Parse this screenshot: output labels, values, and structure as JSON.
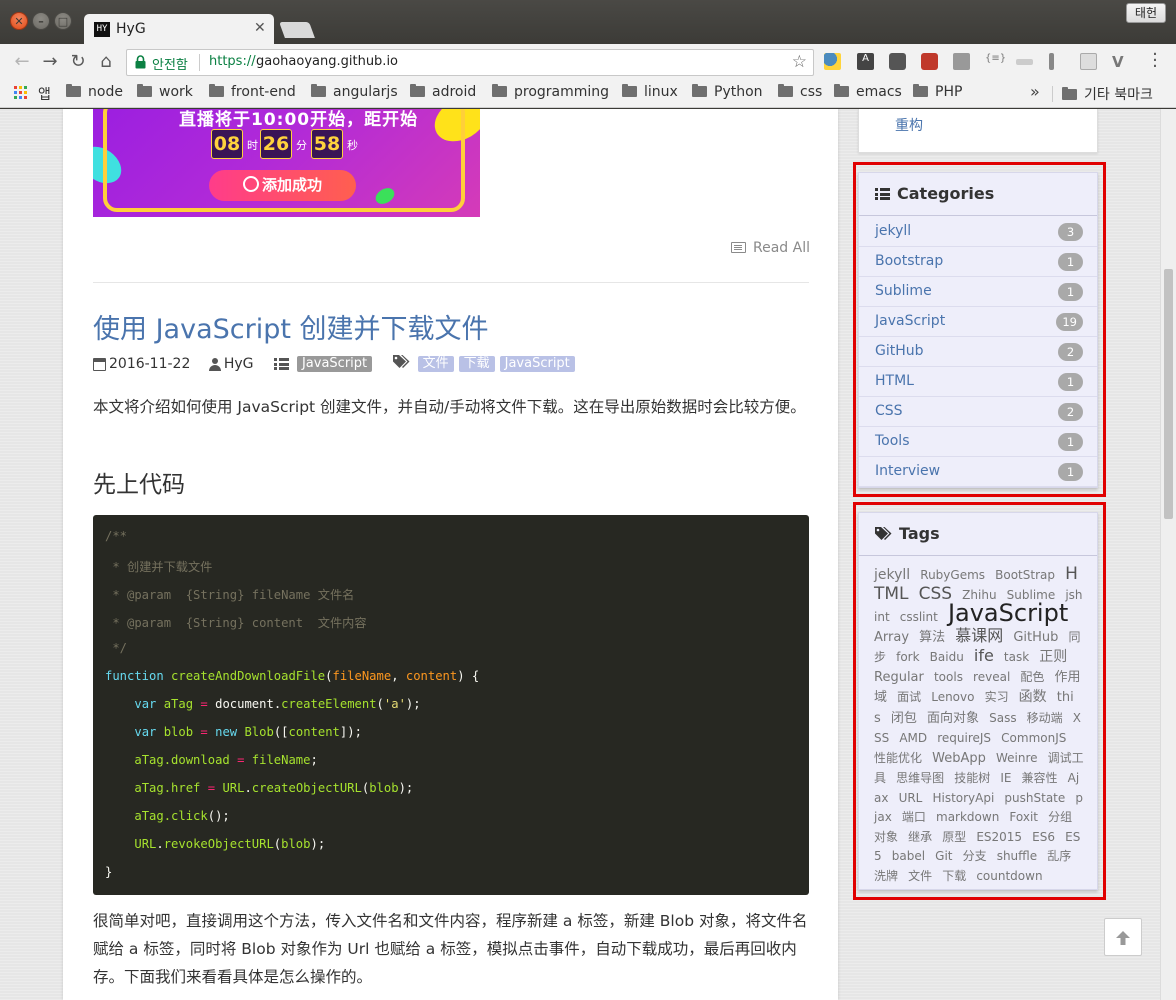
{
  "window": {
    "tab_title": "HyG",
    "favicon_text": "HY",
    "profile_button": "태헌"
  },
  "toolbar": {
    "secure_label": "안전함",
    "url_scheme": "https://",
    "url_host": "gaohaoyang.github.io"
  },
  "bookmarks": {
    "apps_label": "앱",
    "items": [
      "node",
      "work",
      "front-end",
      "angularjs",
      "adroid",
      "programming",
      "linux",
      "Python",
      "css",
      "emacs",
      "PHP"
    ],
    "more": "»",
    "other": "기타 북마크"
  },
  "banner": {
    "top_text": "直播将于10:00开始，距开始",
    "hours": "08",
    "hours_unit": "时",
    "minutes": "26",
    "minutes_unit": "分",
    "seconds": "58",
    "seconds_unit": "秒",
    "button": "添加成功",
    "colors": {
      "bg": "#a828dc",
      "frame": "#ffcf3a",
      "button": "#ff4a73"
    }
  },
  "read_all": "Read All",
  "post": {
    "title": "使用 JavaScript 创建并下载文件",
    "date": "2016-11-22",
    "author": "HyG",
    "category": "JavaScript",
    "tags": [
      "文件",
      "下载",
      "JavaScript"
    ],
    "intro": "本文将介绍如何使用 JavaScript 创建文件，并自动/手动将文件下载。这在导出原始数据时会比较方便。",
    "heading": "先上代码",
    "code": {
      "l1": "/**",
      "l2": " * 创建并下载文件",
      "l3": " * @param  {String} fileName 文件名",
      "l4": " * @param  {String} content  文件内容",
      "l5": " */",
      "l6_kw": "function",
      "l6_fn": "createAndDownloadFile",
      "l6_p1": "fileName",
      "l6_p2": "content",
      "l7_kw": "var",
      "l7_var": "aTag",
      "l7_obj": "document",
      "l7_m": "createElement",
      "l7_str": "'a'",
      "l8_kw": "var",
      "l8_var": "blob",
      "l8_new": "new",
      "l8_cls": "Blob",
      "l8_arg": "content",
      "l9_a": "aTag.download",
      "l9_b": "fileName",
      "l10_a": "aTag.href",
      "l10_obj": "URL",
      "l10_m": "createObjectURL",
      "l10_arg": "blob",
      "l11": "aTag.click",
      "l12_obj": "URL",
      "l12_m": "revokeObjectURL",
      "l12_arg": "blob",
      "l13": "}"
    },
    "outro": "很简单对吧，直接调用这个方法，传入文件名和文件内容，程序新建 a 标签，新建 Blob 对象，将文件名赋给 a 标签，同时将 Blob 对象作为 Url 也赋给 a 标签，模拟点击事件，自动下载成功，最后再回收内存。下面我们来看看具体是怎么操作的。"
  },
  "sidebar": {
    "top_link": "重构",
    "categories_title": "Categories",
    "categories": [
      {
        "name": "jekyll",
        "count": "3"
      },
      {
        "name": "Bootstrap",
        "count": "1"
      },
      {
        "name": "Sublime",
        "count": "1"
      },
      {
        "name": "JavaScript",
        "count": "19"
      },
      {
        "name": "GitHub",
        "count": "2"
      },
      {
        "name": "HTML",
        "count": "1"
      },
      {
        "name": "CSS",
        "count": "2"
      },
      {
        "name": "Tools",
        "count": "1"
      },
      {
        "name": "Interview",
        "count": "1"
      }
    ],
    "tags_title": "Tags",
    "tags": [
      {
        "t": "jekyll",
        "s": 14
      },
      {
        "t": "RubyGems",
        "s": 12
      },
      {
        "t": "BootStrap",
        "s": 12
      },
      {
        "t": "HTML",
        "s": 17
      },
      {
        "t": "CSS",
        "s": 17
      },
      {
        "t": "Zhihu",
        "s": 12
      },
      {
        "t": "Sublime",
        "s": 12
      },
      {
        "t": "jshint",
        "s": 12
      },
      {
        "t": "csslint",
        "s": 12
      },
      {
        "t": "JavaScript",
        "s": 24
      },
      {
        "t": "Array",
        "s": 13
      },
      {
        "t": "算法",
        "s": 13
      },
      {
        "t": "慕课网",
        "s": 16
      },
      {
        "t": "GitHub",
        "s": 13
      },
      {
        "t": "同步",
        "s": 12
      },
      {
        "t": "fork",
        "s": 12
      },
      {
        "t": "Baidu",
        "s": 12
      },
      {
        "t": "ife",
        "s": 16
      },
      {
        "t": "task",
        "s": 12
      },
      {
        "t": "正则",
        "s": 14
      },
      {
        "t": "Regular",
        "s": 13
      },
      {
        "t": "tools",
        "s": 12
      },
      {
        "t": "reveal",
        "s": 12
      },
      {
        "t": "配色",
        "s": 12
      },
      {
        "t": "作用域",
        "s": 13
      },
      {
        "t": "面试",
        "s": 12
      },
      {
        "t": "Lenovo",
        "s": 12
      },
      {
        "t": "实习",
        "s": 12
      },
      {
        "t": "函数",
        "s": 14
      },
      {
        "t": "this",
        "s": 13
      },
      {
        "t": "闭包",
        "s": 13
      },
      {
        "t": "面向对象",
        "s": 13
      },
      {
        "t": "Sass",
        "s": 12
      },
      {
        "t": "移动端",
        "s": 12
      },
      {
        "t": "XSS",
        "s": 12
      },
      {
        "t": "AMD",
        "s": 12
      },
      {
        "t": "requireJS",
        "s": 12
      },
      {
        "t": "CommonJS",
        "s": 12
      },
      {
        "t": "性能优化",
        "s": 12
      },
      {
        "t": "WebApp",
        "s": 13
      },
      {
        "t": "Weinre",
        "s": 12
      },
      {
        "t": "调试工具",
        "s": 12
      },
      {
        "t": "思维导图",
        "s": 12
      },
      {
        "t": "技能树",
        "s": 12
      },
      {
        "t": "IE",
        "s": 12
      },
      {
        "t": "兼容性",
        "s": 12
      },
      {
        "t": "Ajax",
        "s": 12
      },
      {
        "t": "URL",
        "s": 12
      },
      {
        "t": "HistoryApi",
        "s": 12
      },
      {
        "t": "pushState",
        "s": 12
      },
      {
        "t": "pjax",
        "s": 12
      },
      {
        "t": "端口",
        "s": 12
      },
      {
        "t": "markdown",
        "s": 12
      },
      {
        "t": "Foxit",
        "s": 12
      },
      {
        "t": "分组",
        "s": 12
      },
      {
        "t": "对象",
        "s": 12
      },
      {
        "t": "继承",
        "s": 12
      },
      {
        "t": "原型",
        "s": 12
      },
      {
        "t": "ES2015",
        "s": 12
      },
      {
        "t": "ES6",
        "s": 12
      },
      {
        "t": "ES5",
        "s": 12
      },
      {
        "t": "babel",
        "s": 12
      },
      {
        "t": "Git",
        "s": 12
      },
      {
        "t": "分支",
        "s": 12
      },
      {
        "t": "shuffle",
        "s": 12
      },
      {
        "t": "乱序",
        "s": 12
      },
      {
        "t": "洗牌",
        "s": 12
      },
      {
        "t": "文件",
        "s": 12
      },
      {
        "t": "下载",
        "s": 12
      },
      {
        "t": "countdown",
        "s": 12
      }
    ]
  },
  "icons": {
    "back": "back-icon",
    "forward": "forward-icon",
    "reload": "reload-icon",
    "home": "home-icon",
    "star": "star-icon",
    "menu": "menu-icon",
    "to_top": "arrow-up-icon"
  }
}
